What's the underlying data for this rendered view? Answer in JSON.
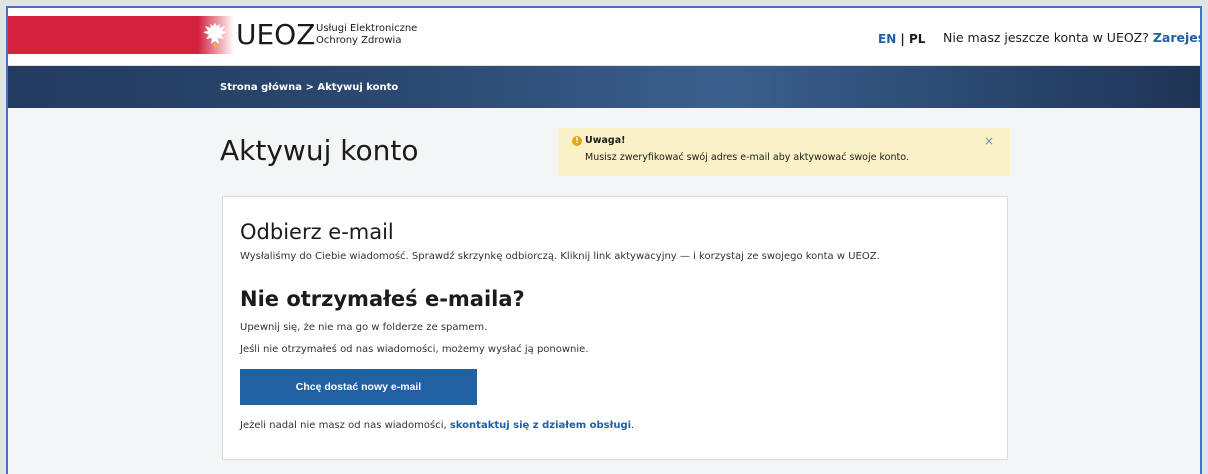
{
  "header": {
    "logo_text": "UEOZ",
    "logo_sub_line1": "Usługi Elektroniczne",
    "logo_sub_line2": "Ochrony Zdrowia",
    "lang_en": "EN",
    "lang_sep": " | ",
    "lang_pl": "PL",
    "register_prompt": "Nie masz jeszcze konta w UEOZ? ",
    "register_link": "Zarejestruj się"
  },
  "breadcrumb": {
    "home": "Strona główna",
    "separator": " > ",
    "current": "Aktywuj konto"
  },
  "page": {
    "title": "Aktywuj konto"
  },
  "alert": {
    "icon": "warning-icon",
    "title": "Uwaga!",
    "message": "Musisz zweryfikować swój adres e-mail aby aktywować swoje konto.",
    "close": "×"
  },
  "card": {
    "heading1": "Odbierz e-mail",
    "text1": "Wysłaliśmy do Ciebie wiadomość. Sprawdź skrzynkę odbiorczą. Kliknij link aktywacyjny — i korzystaj ze swojego konta w UEOZ.",
    "heading2": "Nie otrzymałeś e-maila?",
    "text2": "Upewnij się, że nie ma go w folderze ze spamem.",
    "text3": "Jeśli nie otrzymałeś od nas wiadomości, możemy wysłać ją ponownie.",
    "button_label": "Chcę dostać nowy e-mail",
    "text4_prefix": "Jeżeli nadal nie masz od nas wiadomości, ",
    "text4_link": "skontaktuj się z działem obsługi",
    "text4_suffix": "."
  },
  "colors": {
    "brand_red": "#d4213d",
    "link_blue": "#1f5fa3",
    "button_blue": "#1f61a3",
    "alert_bg": "#fbf1c7",
    "nav_dark": "#233b5f"
  }
}
